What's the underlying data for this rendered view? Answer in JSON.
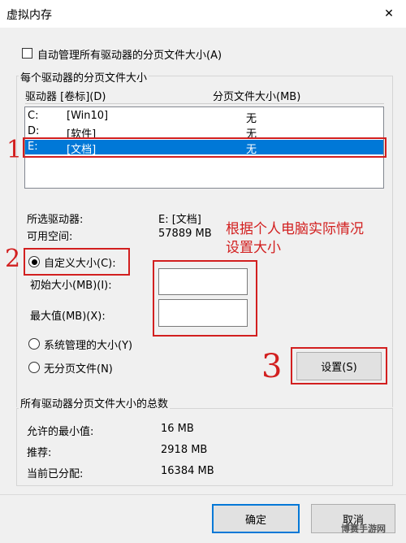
{
  "window": {
    "title": "虚拟内存",
    "close_glyph": "✕"
  },
  "auto_manage": {
    "label": "自动管理所有驱动器的分页文件大小(A)",
    "checked": false
  },
  "drives_group": {
    "legend": "每个驱动器的分页文件大小",
    "col_drive": "驱动器 [卷标](D)",
    "col_size": "分页文件大小(MB)",
    "rows": [
      {
        "drive": "C:",
        "label": "[Win10]",
        "size": "无"
      },
      {
        "drive": "D:",
        "label": "[软件]",
        "size": "无"
      },
      {
        "drive": "E:",
        "label": "[文档]",
        "size": "无"
      }
    ],
    "selected_index": 2
  },
  "selected_drive": {
    "label": "所选驱动器:",
    "value": "E:  [文档]"
  },
  "free_space": {
    "label": "可用空间:",
    "value": "57889 MB"
  },
  "options": {
    "custom_size": "自定义大小(C):",
    "initial_size": "初始大小(MB)(I):",
    "initial_value": "",
    "max_size": "最大值(MB)(X):",
    "max_value": "",
    "system_managed": "系统管理的大小(Y)",
    "no_paging": "无分页文件(N)",
    "selected": "custom_size"
  },
  "set_button": "设置(S)",
  "total_group": {
    "legend": "所有驱动器分页文件大小的总数",
    "min_label": "允许的最小值:",
    "min_value": "16 MB",
    "recommended_label": "推荐:",
    "recommended_value": "2918 MB",
    "current_label": "当前已分配:",
    "current_value": "16384 MB"
  },
  "footer": {
    "ok": "确定",
    "cancel": "取消"
  },
  "annotations": {
    "note": [
      "根据个人电脑实际情况",
      "设置大小"
    ],
    "step1": "1",
    "step2": "2",
    "step3": "3",
    "color": "#d21f1f"
  },
  "watermark": "博赛手游网"
}
